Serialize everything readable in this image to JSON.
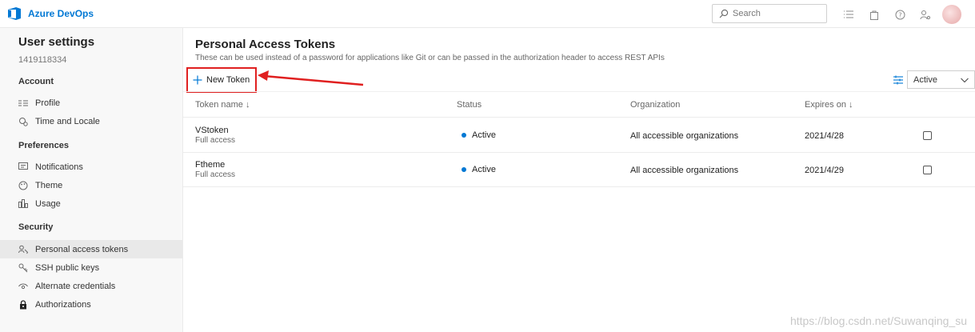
{
  "header": {
    "brand": "Azure DevOps",
    "search_placeholder": "Search",
    "icons": [
      "list-icon",
      "shopping-bag-icon",
      "help-icon",
      "user-settings-icon"
    ],
    "accent_color": "#0078d4"
  },
  "sidebar": {
    "title": "User settings",
    "user_id": "1419118334",
    "sections": [
      {
        "label": "Account",
        "items": [
          {
            "label": "Profile",
            "icon": "profile-icon"
          },
          {
            "label": "Time and Locale",
            "icon": "globe-icon"
          }
        ]
      },
      {
        "label": "Preferences",
        "items": [
          {
            "label": "Notifications",
            "icon": "message-icon"
          },
          {
            "label": "Theme",
            "icon": "palette-icon"
          },
          {
            "label": "Usage",
            "icon": "chart-icon"
          }
        ]
      },
      {
        "label": "Security",
        "items": [
          {
            "label": "Personal access tokens",
            "icon": "key-people-icon",
            "selected": true
          },
          {
            "label": "SSH public keys",
            "icon": "key-icon"
          },
          {
            "label": "Alternate credentials",
            "icon": "eye-icon"
          },
          {
            "label": "Authorizations",
            "icon": "lock-icon"
          }
        ]
      }
    ]
  },
  "main": {
    "title": "Personal Access Tokens",
    "description": "These can be used instead of a password for applications like Git or can be passed in the authorization header to access REST APIs",
    "new_token_label": "New Token",
    "filter_value": "Active",
    "columns": [
      "Token name ↓",
      "Status",
      "Organization",
      "Expires on ↓"
    ],
    "tokens": [
      {
        "name": "VStoken",
        "access": "Full access",
        "status": "Active",
        "organization": "All accessible organizations",
        "expires": "2021/4/28"
      },
      {
        "name": "Ftheme",
        "access": "Full access",
        "status": "Active",
        "organization": "All accessible organizations",
        "expires": "2021/4/29"
      }
    ]
  },
  "watermark": "https://blog.csdn.net/Suwanqing_su",
  "annotation_color": "#e02020"
}
